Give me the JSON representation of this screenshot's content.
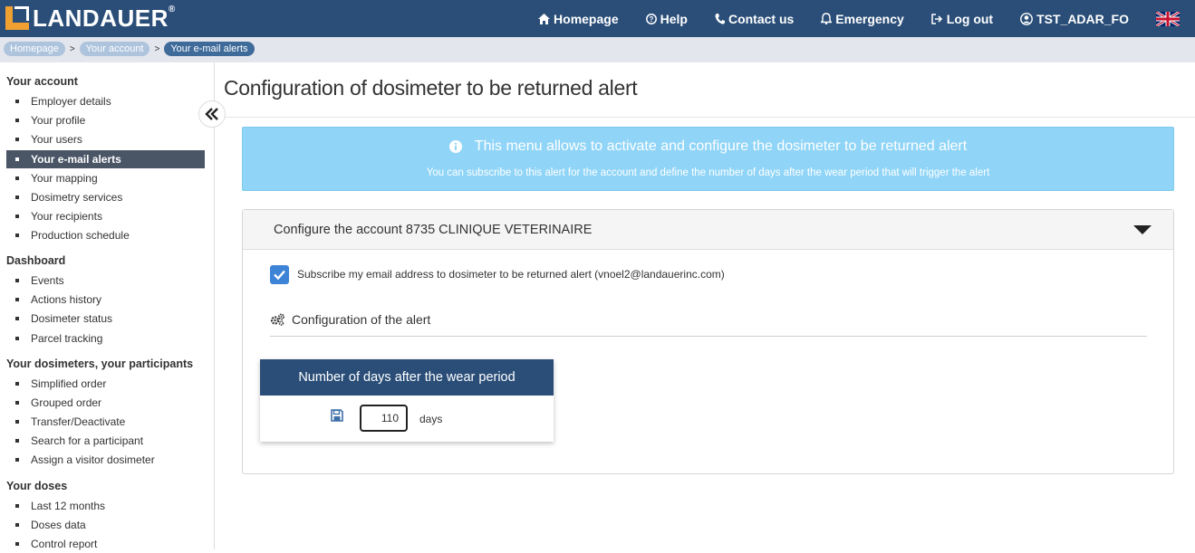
{
  "brand": {
    "name": "LANDAUER",
    "reg": "®"
  },
  "nav": {
    "homepage": "Homepage",
    "help": "Help",
    "contact": "Contact us",
    "emergency": "Emergency",
    "logout": "Log out",
    "user": "TST_ADAR_FO"
  },
  "breadcrumb": {
    "items": [
      "Homepage",
      "Your account",
      "Your e-mail alerts"
    ],
    "separator": ">"
  },
  "sidebar": {
    "sections": [
      {
        "title": "Your account",
        "items": [
          "Employer details",
          "Your profile",
          "Your users",
          "Your e-mail alerts",
          "Your mapping",
          "Dosimetry services",
          "Your recipients",
          "Production schedule"
        ]
      },
      {
        "title": "Dashboard",
        "items": [
          "Events",
          "Actions history",
          "Dosimeter status",
          "Parcel tracking"
        ]
      },
      {
        "title": "Your dosimeters, your participants",
        "items": [
          "Simplified order",
          "Grouped order",
          "Transfer/Deactivate",
          "Search for a participant",
          "Assign a visitor dosimeter"
        ]
      },
      {
        "title": "Your doses",
        "items": [
          "Last 12 months",
          "Doses data",
          "Control report"
        ]
      }
    ],
    "active_item": "Your e-mail alerts"
  },
  "page": {
    "title": "Configuration of dosimeter to be returned alert",
    "info_main": "This menu allows to activate and configure the dosimeter to be returned alert",
    "info_sub": "You can subscribe to this alert for the account and define the number of days after the wear period that will trigger the alert",
    "panel_title": "Configure the account 8735 CLINIQUE VETERINAIRE",
    "subscribe_label": "Subscribe my email address to dosimeter to be returned alert (vnoel2@landauerinc.com)",
    "subscribe_checked": true,
    "config_heading": "Configuration of the alert",
    "days_header": "Number of days after the wear period",
    "days_value": "110",
    "days_unit": "days"
  },
  "colors": {
    "topbar": "#2a4e78",
    "accent_orange": "#f0a030",
    "info_bg": "#90d5f7",
    "checkbox": "#3d83d6",
    "active_side": "#4a5566"
  }
}
